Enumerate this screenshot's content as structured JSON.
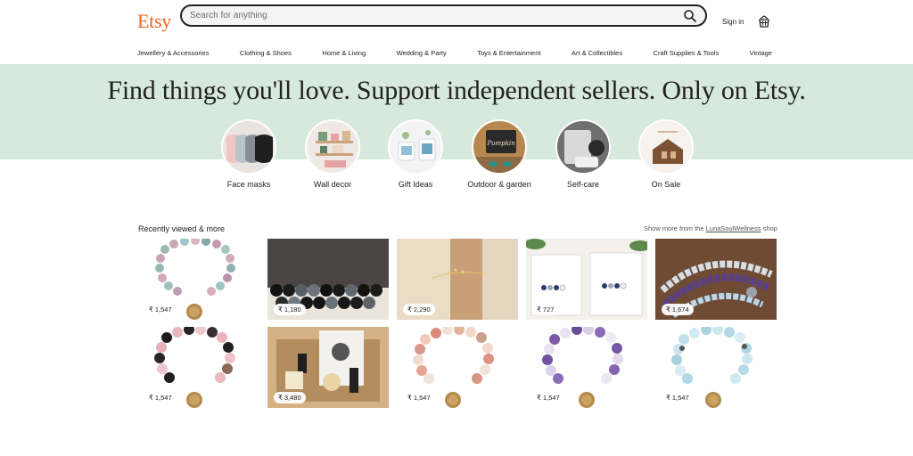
{
  "header": {
    "logo": "Etsy",
    "search_placeholder": "Search for anything",
    "sign_in": "Sign in"
  },
  "nav": [
    "Jewellery & Accessories",
    "Clothing & Shoes",
    "Home & Living",
    "Wedding & Party",
    "Toys & Entertainment",
    "Art & Collectibles",
    "Craft Supplies & Tools",
    "Vintage"
  ],
  "hero": {
    "headline": "Find things you'll love. Support independent sellers. Only on Etsy."
  },
  "categories": [
    {
      "label": "Face masks"
    },
    {
      "label": "Wall decor"
    },
    {
      "label": "Gift Ideas"
    },
    {
      "label": "Outdoor & garden"
    },
    {
      "label": "Self-care"
    },
    {
      "label": "On Sale"
    }
  ],
  "recent": {
    "title": "Recently viewed & more",
    "more_prefix": "Show more from the ",
    "shop_name": "LunaSoulWellness",
    "more_suffix": " shop",
    "items": [
      {
        "price": "₹ 1,547"
      },
      {
        "price": "₹ 1,180"
      },
      {
        "price": "₹ 2,290"
      },
      {
        "price": "₹ 727"
      },
      {
        "price": "₹ 1,674"
      },
      {
        "price": "₹ 1,547"
      },
      {
        "price": "₹ 3,480"
      },
      {
        "price": "₹ 1,547"
      },
      {
        "price": "₹ 1,547"
      },
      {
        "price": "₹ 1,547"
      }
    ]
  },
  "colors": {
    "brand": "#F1641E",
    "hero_bg": "#d7e8dd"
  }
}
